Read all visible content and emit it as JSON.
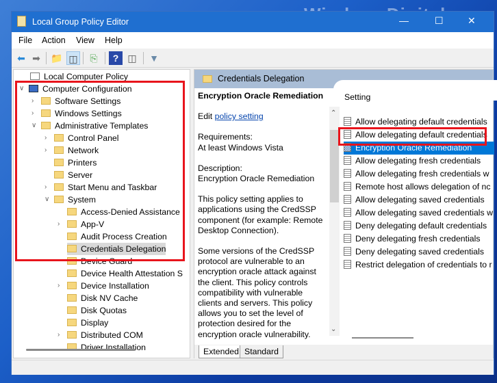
{
  "watermark": "WindowsDigital.com",
  "window": {
    "title": "Local Group Policy Editor"
  },
  "menu": [
    "File",
    "Action",
    "View",
    "Help"
  ],
  "toolbar": [
    "back-icon",
    "forward-icon",
    "up-folder-icon",
    "show-hide-tree-icon",
    "export-list-icon",
    "help-icon",
    "show-action-pane-icon",
    "filter-icon"
  ],
  "tree": [
    {
      "label": "Local Computer Policy",
      "level": 0,
      "exp": ""
    },
    {
      "label": "Computer Configuration",
      "level": 1,
      "exp": "open"
    },
    {
      "label": "Software Settings",
      "level": 2,
      "exp": "closed"
    },
    {
      "label": "Windows Settings",
      "level": 2,
      "exp": "closed"
    },
    {
      "label": "Administrative Templates",
      "level": 2,
      "exp": "open"
    },
    {
      "label": "Control Panel",
      "level": 3,
      "exp": "closed"
    },
    {
      "label": "Network",
      "level": 3,
      "exp": "closed"
    },
    {
      "label": "Printers",
      "level": 3,
      "exp": ""
    },
    {
      "label": "Server",
      "level": 3,
      "exp": ""
    },
    {
      "label": "Start Menu and Taskbar",
      "level": 3,
      "exp": "closed"
    },
    {
      "label": "System",
      "level": 3,
      "exp": "open"
    },
    {
      "label": "Access-Denied Assistance",
      "level": 4,
      "exp": ""
    },
    {
      "label": "App-V",
      "level": 4,
      "exp": "closed"
    },
    {
      "label": "Audit Process Creation",
      "level": 4,
      "exp": ""
    },
    {
      "label": "Credentials Delegation",
      "level": 4,
      "exp": "",
      "selected": true
    },
    {
      "label": "Device Guard",
      "level": 4,
      "exp": ""
    },
    {
      "label": "Device Health Attestation S",
      "level": 4,
      "exp": ""
    },
    {
      "label": "Device Installation",
      "level": 4,
      "exp": "closed"
    },
    {
      "label": "Disk NV Cache",
      "level": 4,
      "exp": ""
    },
    {
      "label": "Disk Quotas",
      "level": 4,
      "exp": ""
    },
    {
      "label": "Display",
      "level": 4,
      "exp": ""
    },
    {
      "label": "Distributed COM",
      "level": 4,
      "exp": "closed"
    },
    {
      "label": "Driver Installation",
      "level": 4,
      "exp": ""
    }
  ],
  "right": {
    "header": "Credentials Delegation",
    "desc_title": "Encryption Oracle Remediation",
    "edit_prefix": "Edit ",
    "edit_link": "policy setting ",
    "requirements_label": "Requirements:",
    "requirements": "At least Windows Vista",
    "description_label": "Description:",
    "description": "Encryption Oracle Remediation",
    "para1": "This policy setting applies to applications using the CredSSP component (for example: Remote Desktop Connection).",
    "para2": "Some versions of the CredSSP protocol are vulnerable to an encryption oracle attack against the client.  This policy controls compatibility with vulnerable clients and servers.  This policy allows you to set the level of protection desired for the encryption oracle vulnerability.",
    "column": "Setting",
    "settings": [
      "Allow delegating default credentials",
      "Allow delegating default credentials",
      "Encryption Oracle Remediation",
      "Allow delegating fresh credentials",
      "Allow delegating fresh credentials w",
      "Remote host allows delegation of nc",
      "Allow delegating saved credentials",
      "Allow delegating saved credentials w",
      "Deny delegating default credentials",
      "Deny delegating fresh credentials",
      "Deny delegating saved credentials",
      "Restrict delegation of credentials to r"
    ],
    "selected_index": 2,
    "tabs": [
      "Extended",
      "Standard"
    ]
  },
  "colors": {
    "highlight": "#e8141c",
    "selection": "#0078d7",
    "titlebar": "#1f6fd0"
  }
}
